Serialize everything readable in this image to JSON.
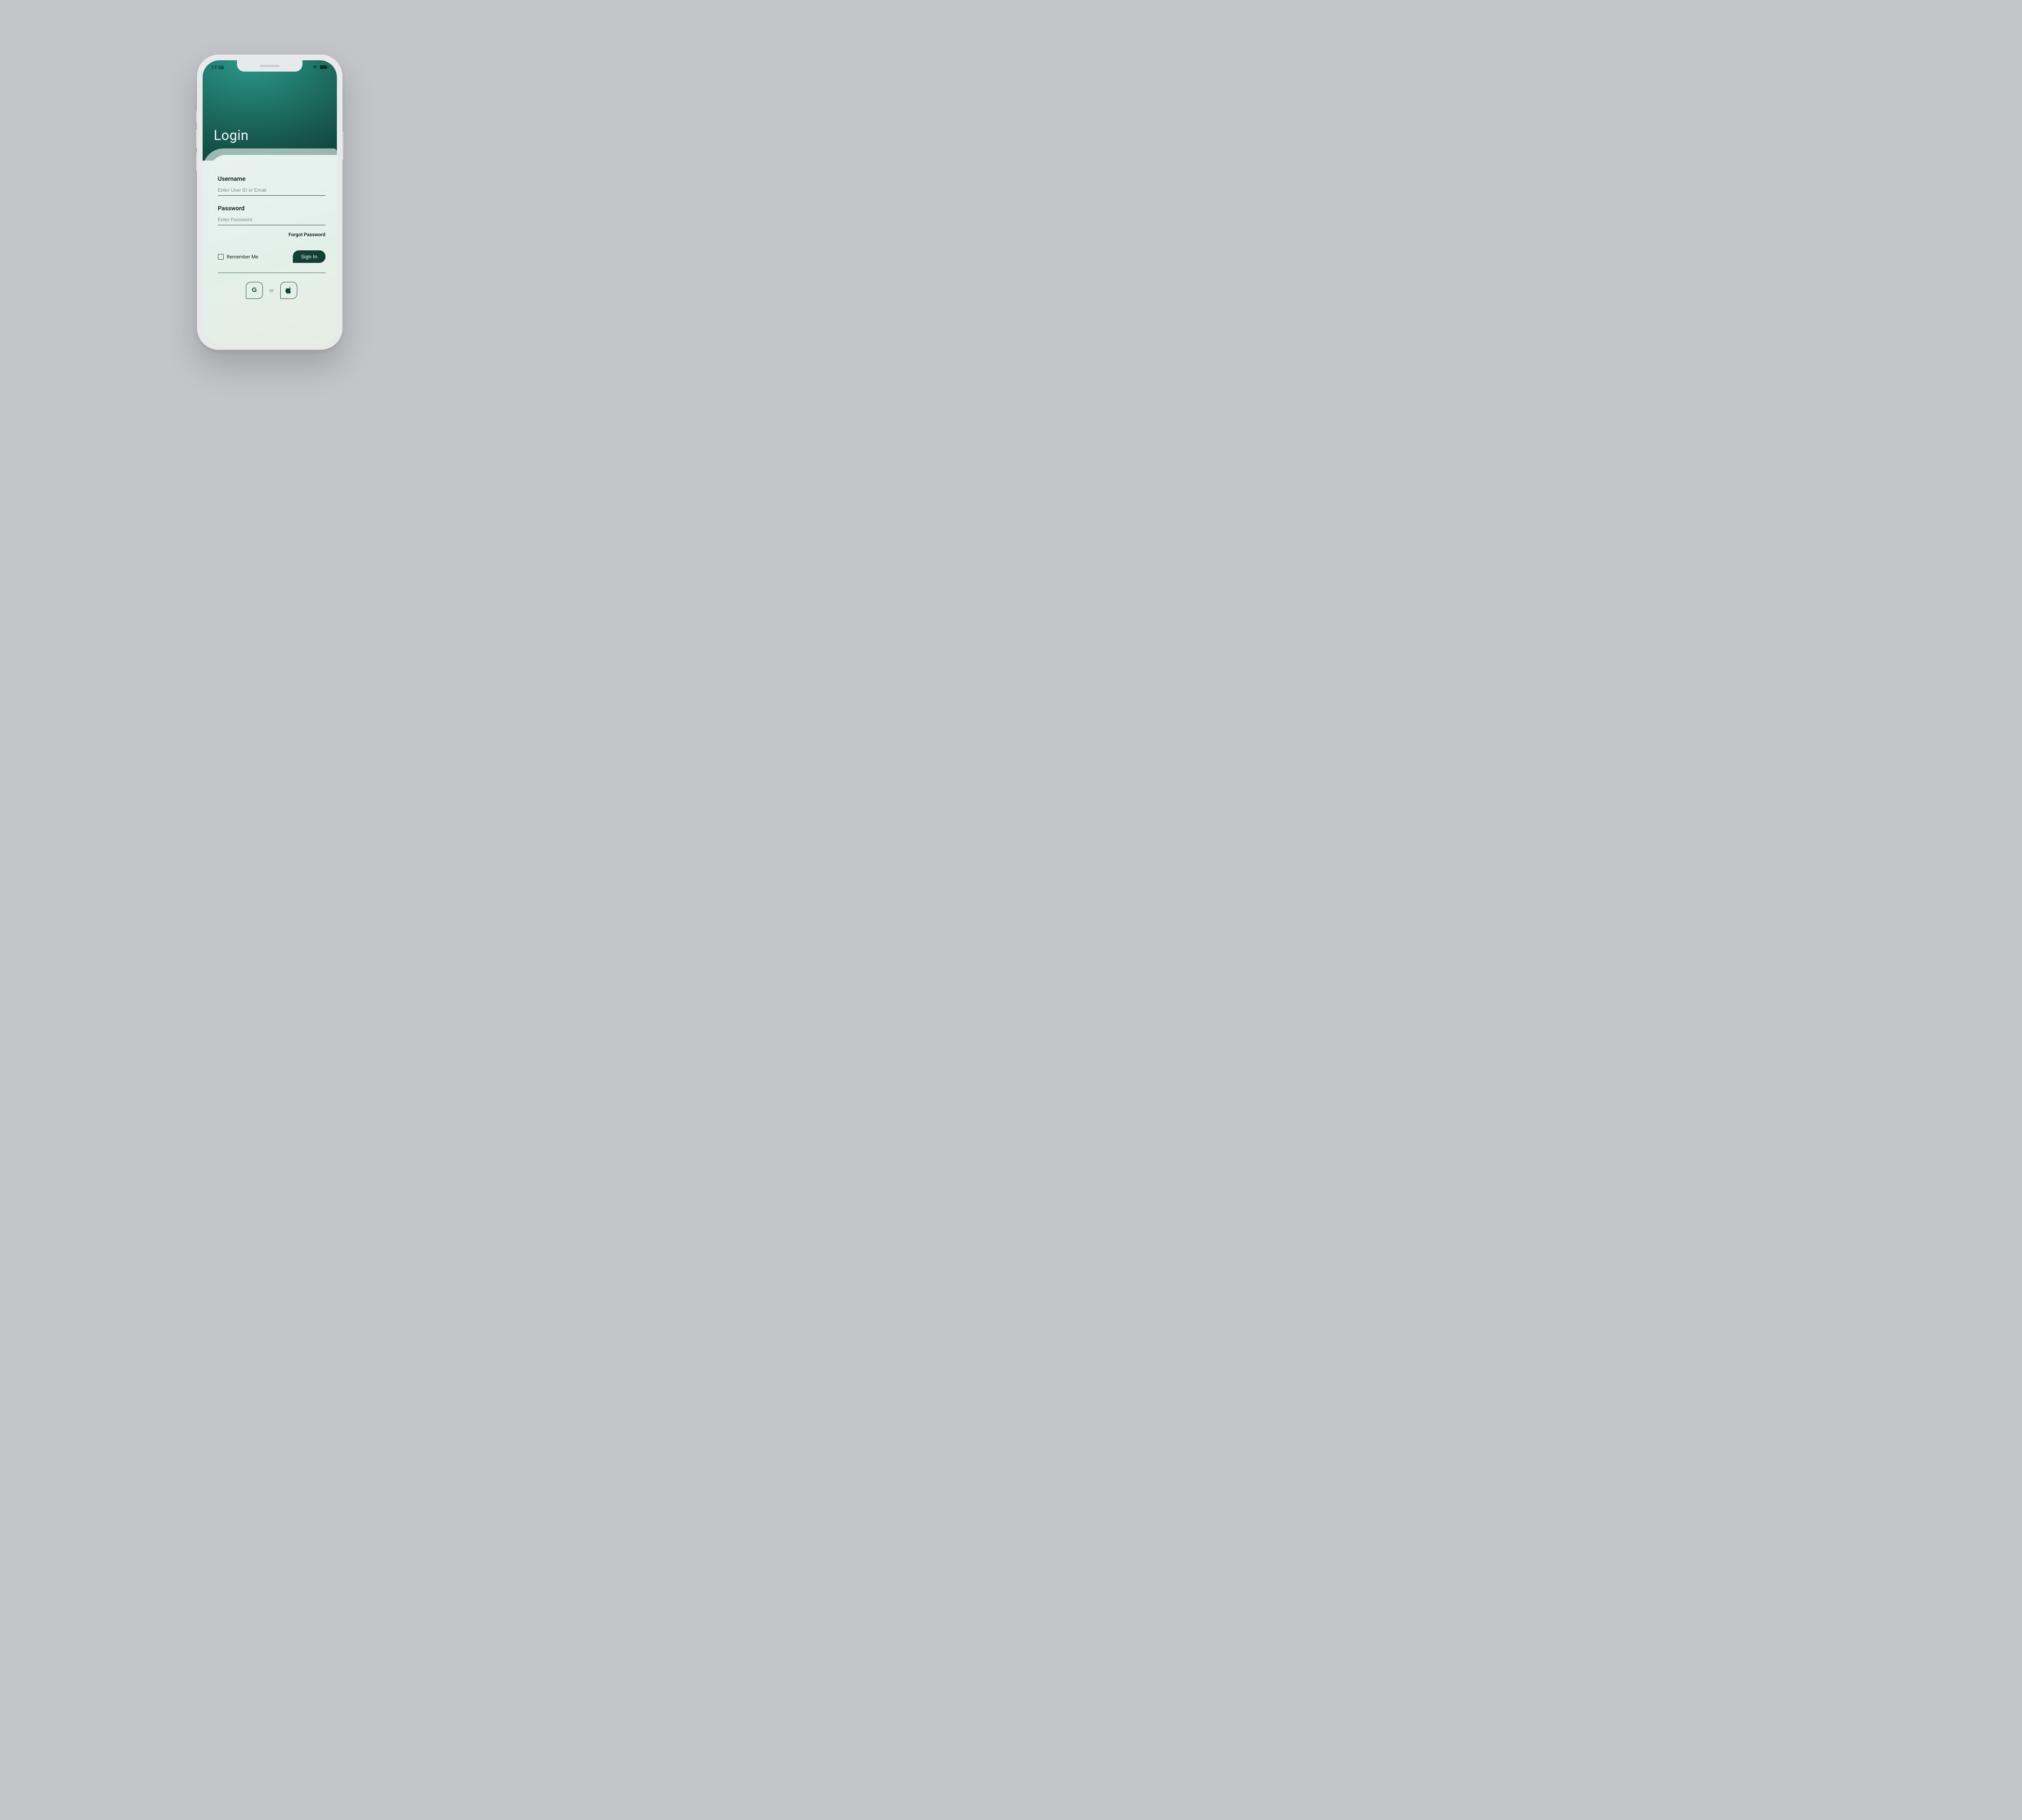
{
  "status": {
    "time": "17:58"
  },
  "header": {
    "title": "Login"
  },
  "form": {
    "username": {
      "label": "Username",
      "placeholder": "Enter User ID or Email",
      "value": ""
    },
    "password": {
      "label": "Password",
      "placeholder": "Enter Password",
      "value": ""
    },
    "forgot_label": "Forgot Password",
    "remember_label": "Remember Me",
    "remember_checked": false,
    "submit_label": "Sign In"
  },
  "social": {
    "or_label": "or",
    "google_label": "G"
  },
  "colors": {
    "accent": "#123f36",
    "hero_start": "#2b9789",
    "hero_end": "#0e3a33"
  }
}
